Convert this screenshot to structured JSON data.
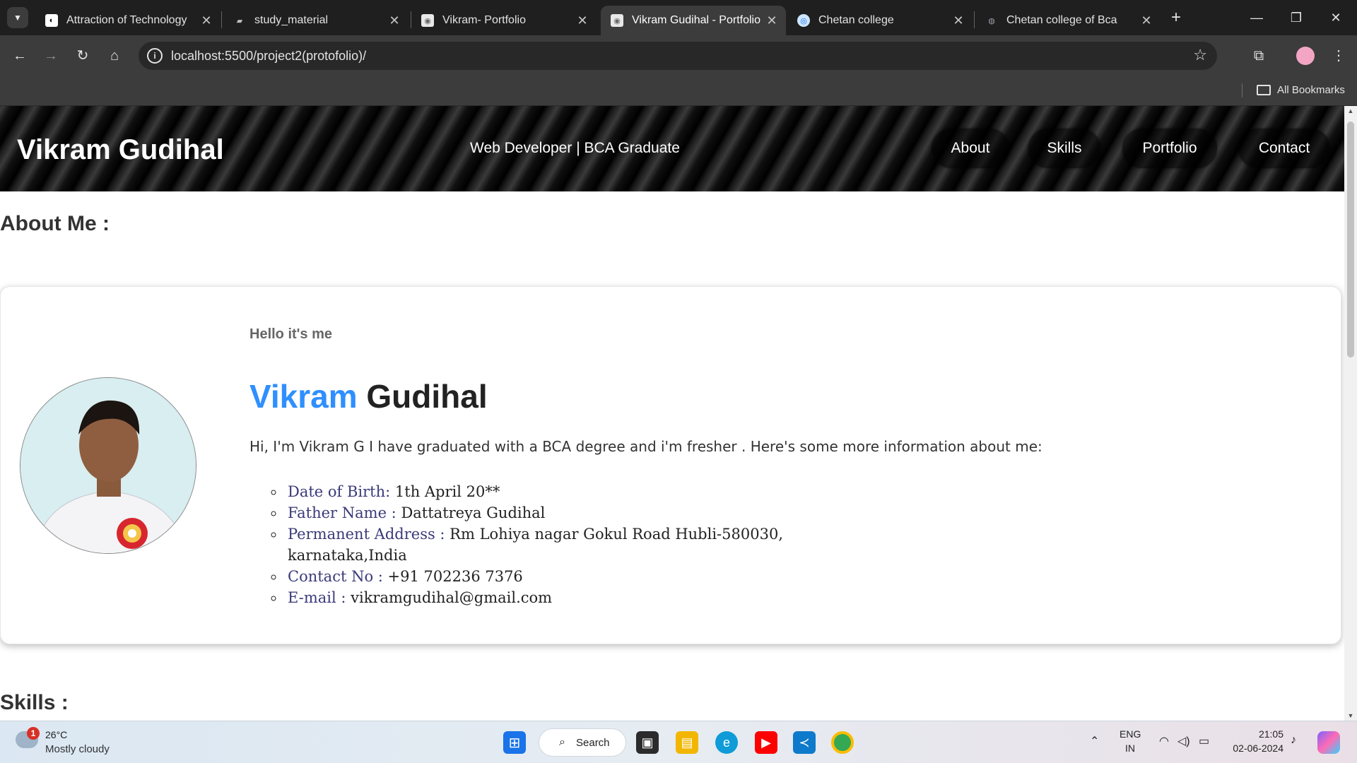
{
  "browser": {
    "tabs": [
      {
        "title": "Attraction of Technology"
      },
      {
        "title": "study_material"
      },
      {
        "title": "Vikram- Portfolio"
      },
      {
        "title": "Vikram Gudihal - Portfolio"
      },
      {
        "title": "Chetan college"
      },
      {
        "title": "Chetan college of Bca"
      }
    ],
    "active_tab_index": 3,
    "url": "localhost:5500/project2(protofolio)/",
    "bookmarks_label": "All Bookmarks"
  },
  "site": {
    "brand": "Vikram Gudihal",
    "tagline": "Web Developer | BCA Graduate",
    "nav": [
      "About",
      "Skills",
      "Portfolio",
      "Contact"
    ]
  },
  "about": {
    "title": "About Me :",
    "hello": "Hello it's me",
    "first_name": "Vikram",
    "last_name": "Gudihal",
    "intro": "Hi, I'm Vikram G I have graduated with a BCA degree and i'm fresher . Here's some more information about me:",
    "details": [
      {
        "label": "Date of Birth:",
        "value": " 1th April 20**"
      },
      {
        "label": "Father Name :",
        "value": " Dattatreya Gudihal"
      },
      {
        "label": "Permanent Address :",
        "value": " Rm Lohiya nagar Gokul Road Hubli-580030, karnataka,India"
      },
      {
        "label": "Contact No :",
        "value": " +91 702236 7376"
      },
      {
        "label": "E-mail :",
        "value": " vikramgudihal@gmail.com"
      }
    ]
  },
  "skills": {
    "title": "Skills :"
  },
  "taskbar": {
    "weather_badge": "1",
    "temperature": "26°C",
    "condition": "Mostly cloudy",
    "search_label": "Search",
    "lang": "ENG",
    "region": "IN",
    "time": "21:05",
    "date": "02-06-2024"
  },
  "colors": {
    "accent_name": "#2f8fff",
    "chrome_bg": "#3c3c3c"
  }
}
